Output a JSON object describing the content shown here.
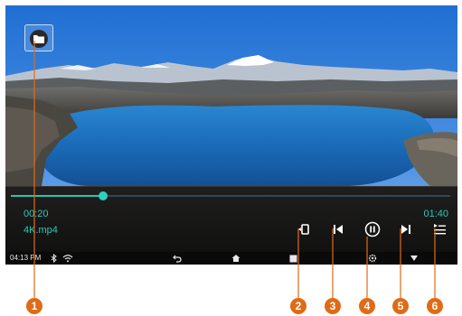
{
  "player": {
    "elapsed": "00:20",
    "total": "01:40",
    "filename": "4K.mp4",
    "progress_fraction": 0.21
  },
  "controls": {
    "items": [
      {
        "icon": "screen-rotate-icon"
      },
      {
        "icon": "previous-track-icon"
      },
      {
        "icon": "pause-icon"
      },
      {
        "icon": "next-track-icon"
      },
      {
        "icon": "playlist-icon"
      }
    ]
  },
  "status_bar": {
    "time": "04:13 PM",
    "icons": [
      "bluetooth-icon",
      "wifi-icon",
      "back-icon",
      "home-icon",
      "recent-apps-icon",
      "settings-icon",
      "down-arrow-icon"
    ]
  },
  "folder_button": {
    "icon": "folder-icon"
  },
  "callouts": {
    "labels": [
      "1",
      "2",
      "3",
      "4",
      "5",
      "6"
    ],
    "color": "#e06b16"
  },
  "colors": {
    "accent": "#2cc8b4",
    "callout": "#e06b16",
    "status_bar_bg": "#0a0a0a"
  }
}
